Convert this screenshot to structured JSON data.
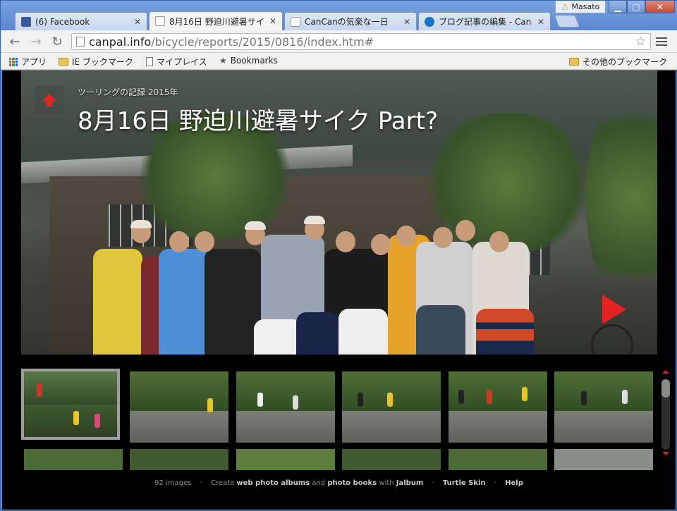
{
  "browser": {
    "tabs": [
      {
        "label": "(6) Facebook",
        "favicon_color": "#3b5998"
      },
      {
        "label": "8月16日 野迫川避暑サイ",
        "favicon_color": "#ffffff"
      },
      {
        "label": "CanCanの気楽な一日",
        "favicon_color": "#ffffff"
      },
      {
        "label": "ブログ記事の編集 - Can",
        "favicon_color": "#1a73c9"
      }
    ],
    "user": "Masato",
    "url_host": "canpal.info",
    "url_path": "/bicycle/reports/2015/0816/index.htm#",
    "bookmarks": [
      "アプリ",
      "IE ブックマーク",
      "マイプレイス",
      "Bookmarks"
    ],
    "other_bookmarks": "その他のブックマーク"
  },
  "page": {
    "breadcrumb": "ツーリングの記録 2015年",
    "title": "8月16日 野迫川避暑サイク Part?",
    "accent_color": "#e52222"
  },
  "footer": {
    "count": "92 images",
    "create": "Create",
    "albums": "web photo albums",
    "and": "and",
    "books": "photo books",
    "with": "with",
    "jalbum": "Jalbum",
    "skin": "Turtle Skin",
    "help": "Help"
  }
}
